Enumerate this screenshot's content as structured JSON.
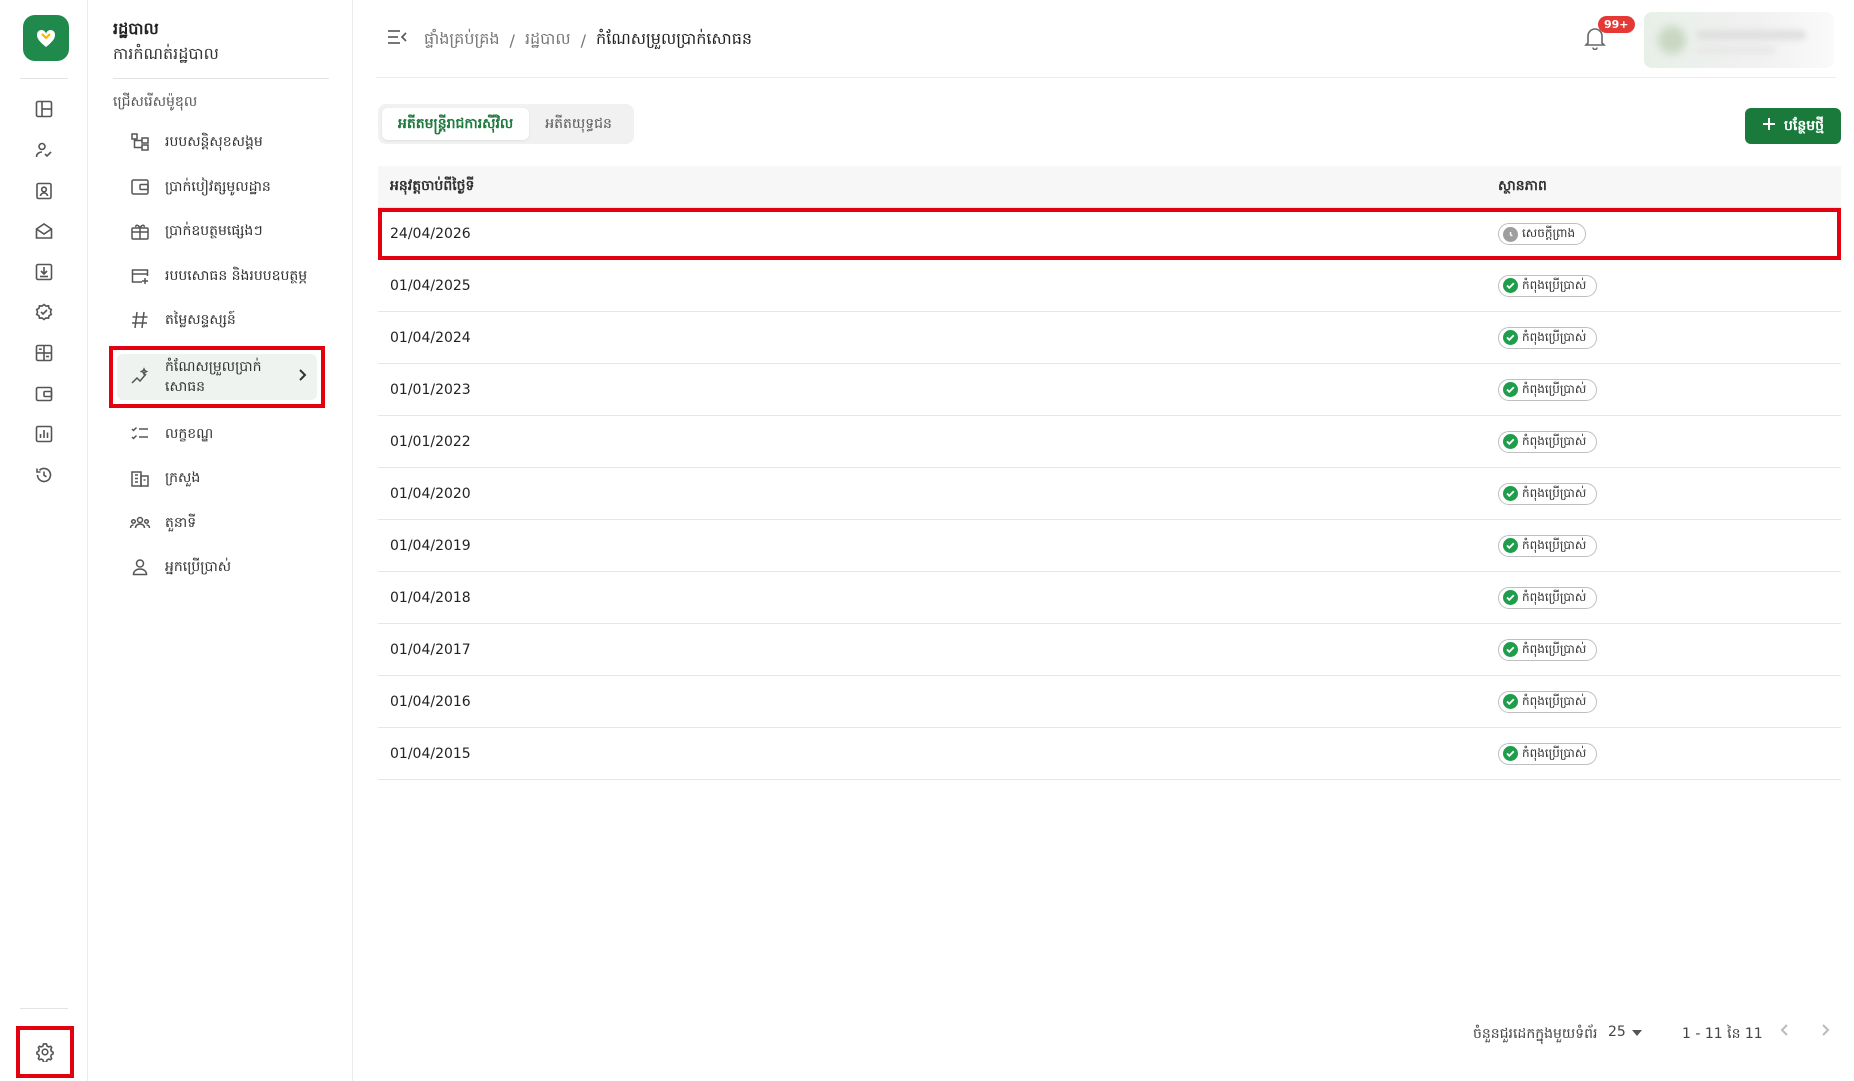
{
  "app": {
    "brand_color": "#1f8a4c",
    "logo_icon": "hands-heart-logo"
  },
  "rail": {
    "icons": [
      "dashboard-icon",
      "user-check-icon",
      "id-card-icon",
      "mail-open-icon",
      "download-box-icon",
      "badge-check-icon",
      "calculator-icon",
      "wallet-icon",
      "bar-chart-icon",
      "history-icon"
    ],
    "bottom_icon": "gear-icon"
  },
  "subnav": {
    "title": "រដ្ឋបាល",
    "subtitle": "ការកំណត់រដ្ឋបាល",
    "section": "ជ្រើសរើសម៉ូឌុល",
    "items": [
      {
        "label": "របបសន្តិសុខសង្គម",
        "icon": "hierarchy-icon"
      },
      {
        "label": "ប្រាក់បៀវត្សមូលដ្ឋាន",
        "icon": "wallet-icon"
      },
      {
        "label": "ប្រាក់ឧបត្ថមផ្សេងៗ",
        "icon": "gift-icon"
      },
      {
        "label": "របបសោធន និងរបបឧបត្ថម្ភ",
        "icon": "card-plus-icon"
      },
      {
        "label": "តម្លៃសន្ទស្សន៍",
        "icon": "hash-icon"
      },
      {
        "label": "កំណែសម្រួលប្រាក់សោធន",
        "icon": "trend-sparkle-icon",
        "active": true
      },
      {
        "label": "លក្ខខណ្ឌ",
        "icon": "checklist-icon"
      },
      {
        "label": "ក្រសួង",
        "icon": "building-icon"
      },
      {
        "label": "តួនាទី",
        "icon": "group-icon"
      },
      {
        "label": "អ្នកប្រើប្រាស់",
        "icon": "person-icon"
      }
    ]
  },
  "topbar": {
    "breadcrumb": [
      "ផ្ទាំងគ្រប់គ្រង",
      "រដ្ឋបាល",
      "កំណែសម្រួលប្រាក់សោធន"
    ],
    "notification_count": "99+"
  },
  "content": {
    "tabs": [
      {
        "label": "អតីតមន្ត្រីរាជការស៊ីវិល",
        "active": true
      },
      {
        "label": "អតីតយុទ្ធជន",
        "active": false
      }
    ],
    "add_button": "បន្ថែមថ្មី",
    "table": {
      "columns": [
        "អនុវត្តចាប់ពីថ្ងៃទី",
        "ស្ថានភាព"
      ],
      "rows": [
        {
          "date": "24/04/2026",
          "status": "សេចក្តីព្រាង",
          "type": "draft"
        },
        {
          "date": "01/04/2025",
          "status": "កំពុងប្រើប្រាស់",
          "type": "active"
        },
        {
          "date": "01/04/2024",
          "status": "កំពុងប្រើប្រាស់",
          "type": "active"
        },
        {
          "date": "01/01/2023",
          "status": "កំពុងប្រើប្រាស់",
          "type": "active"
        },
        {
          "date": "01/01/2022",
          "status": "កំពុងប្រើប្រាស់",
          "type": "active"
        },
        {
          "date": "01/04/2020",
          "status": "កំពុងប្រើប្រាស់",
          "type": "active"
        },
        {
          "date": "01/04/2019",
          "status": "កំពុងប្រើប្រាស់",
          "type": "active"
        },
        {
          "date": "01/04/2018",
          "status": "កំពុងប្រើប្រាស់",
          "type": "active"
        },
        {
          "date": "01/04/2017",
          "status": "កំពុងប្រើប្រាស់",
          "type": "active"
        },
        {
          "date": "01/04/2016",
          "status": "កំពុងប្រើប្រាស់",
          "type": "active"
        },
        {
          "date": "01/04/2015",
          "status": "កំពុងប្រើប្រាស់",
          "type": "active"
        }
      ]
    },
    "pagination": {
      "rows_per_page_label": "ចំនួនជួរដេកក្នុងមួយទំព័រ",
      "rows_per_page": "25",
      "range": "1 - 11 នៃ 11"
    }
  },
  "colors": {
    "active_status": "#1f9d4c",
    "draft_status": "#9e9e9e",
    "highlight": "#e3000f"
  }
}
